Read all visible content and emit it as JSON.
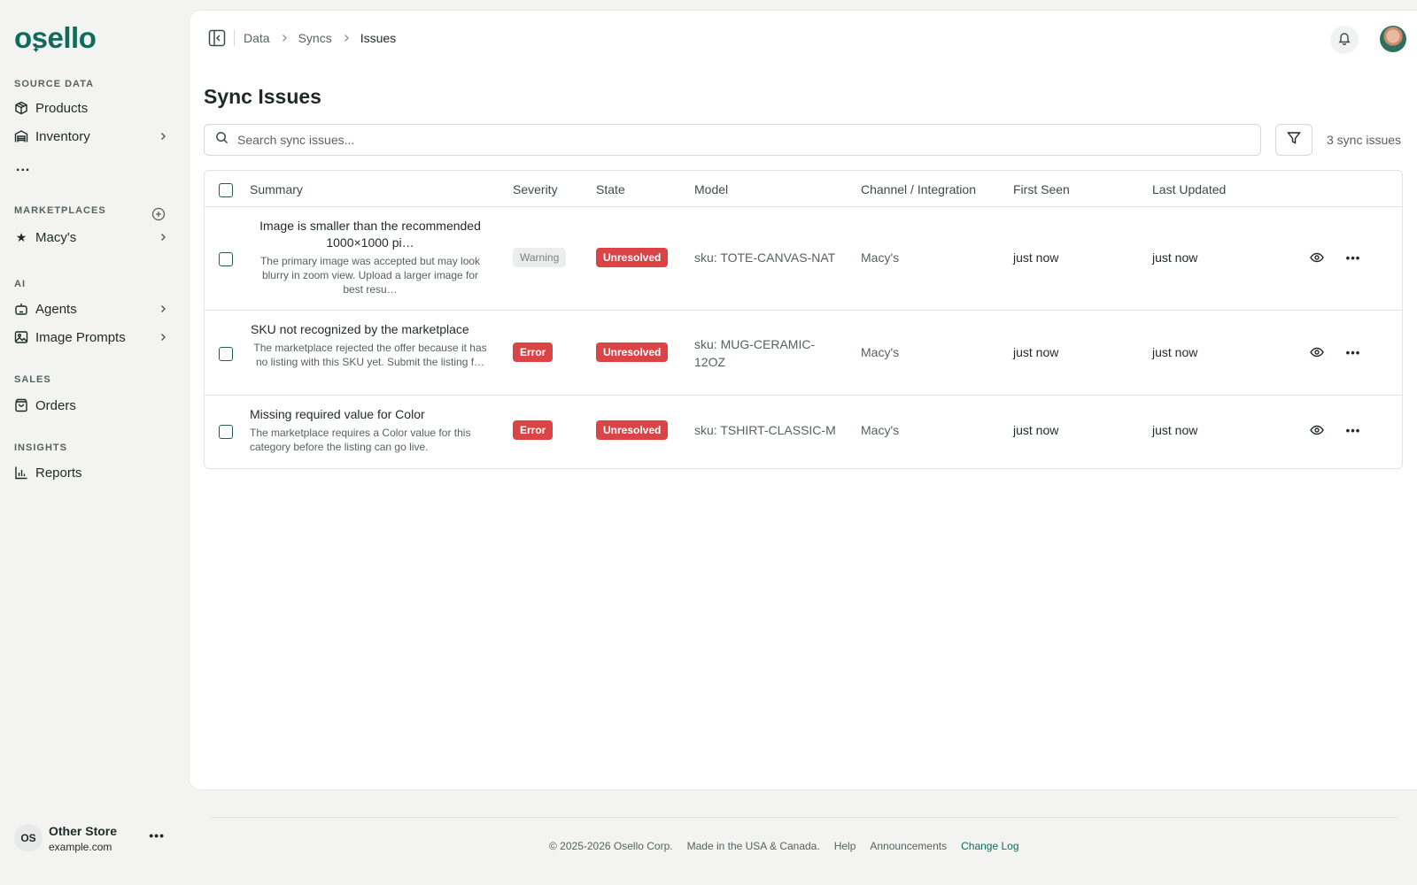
{
  "brand": {
    "logo": "osello"
  },
  "sidebar": {
    "source_data": {
      "heading": "SOURCE DATA",
      "items": [
        {
          "label": "Products",
          "icon": "package-icon"
        },
        {
          "label": "Inventory",
          "icon": "warehouse-icon"
        }
      ],
      "more": "..."
    },
    "marketplaces": {
      "heading": "MARKETPLACES",
      "items": [
        {
          "label": "Macy's",
          "icon": "star-icon"
        }
      ]
    },
    "ai": {
      "heading": "AI",
      "items": [
        {
          "label": "Agents",
          "icon": "robot-icon"
        },
        {
          "label": "Image Prompts",
          "icon": "image-icon"
        }
      ]
    },
    "sales": {
      "heading": "SALES",
      "items": [
        {
          "label": "Orders",
          "icon": "shopping-bag-icon"
        }
      ]
    },
    "insights": {
      "heading": "INSIGHTS",
      "items": [
        {
          "label": "Reports",
          "icon": "bar-chart-icon"
        }
      ]
    },
    "store": {
      "initials": "OS",
      "name": "Other Store",
      "domain": "example.com"
    }
  },
  "breadcrumb": [
    "Data",
    "Syncs",
    "Issues"
  ],
  "page_title": "Sync Issues",
  "search": {
    "placeholder": "Search sync issues...",
    "value": ""
  },
  "issue_count": "3 sync issues",
  "table": {
    "headers": {
      "summary": "Summary",
      "severity": "Severity",
      "state": "State",
      "model": "Model",
      "channel": "Channel / Integration",
      "first_seen": "First Seen",
      "last_updated": "Last Updated"
    },
    "rows": [
      {
        "title": "Image is smaller than the recommended 1000×1000 pi…",
        "description": "The primary image was accepted but may look blurry in zoom view. Upload a larger image for best resu…",
        "severity": "Warning",
        "state": "Unresolved",
        "model": "sku: TOTE-CANVAS-NAT",
        "channel": "Macy's",
        "first_seen": "just now",
        "last_updated": "just now"
      },
      {
        "title": "SKU not recognized by the marketplace",
        "description": "The marketplace rejected the offer because it has no listing with this SKU yet. Submit the listing f…",
        "severity": "Error",
        "state": "Unresolved",
        "model": "sku: MUG-CERAMIC-12OZ",
        "channel": "Macy's",
        "first_seen": "just now",
        "last_updated": "just now"
      },
      {
        "title": "Missing required value for Color",
        "description": "The marketplace requires a Color value for this category before the listing can go live.",
        "severity": "Error",
        "state": "Unresolved",
        "model": "sku: TSHIRT-CLASSIC-M",
        "channel": "Macy's",
        "first_seen": "just now",
        "last_updated": "just now"
      }
    ]
  },
  "footer": {
    "copyright": "© 2025-2026 Osello Corp.",
    "made_in": "Made in the USA & Canada.",
    "help": "Help",
    "announcements": "Announcements",
    "changelog": "Change Log"
  },
  "colors": {
    "brand": "#0f6b5c",
    "error": "#db4446",
    "warning_bg": "#eceeed"
  }
}
